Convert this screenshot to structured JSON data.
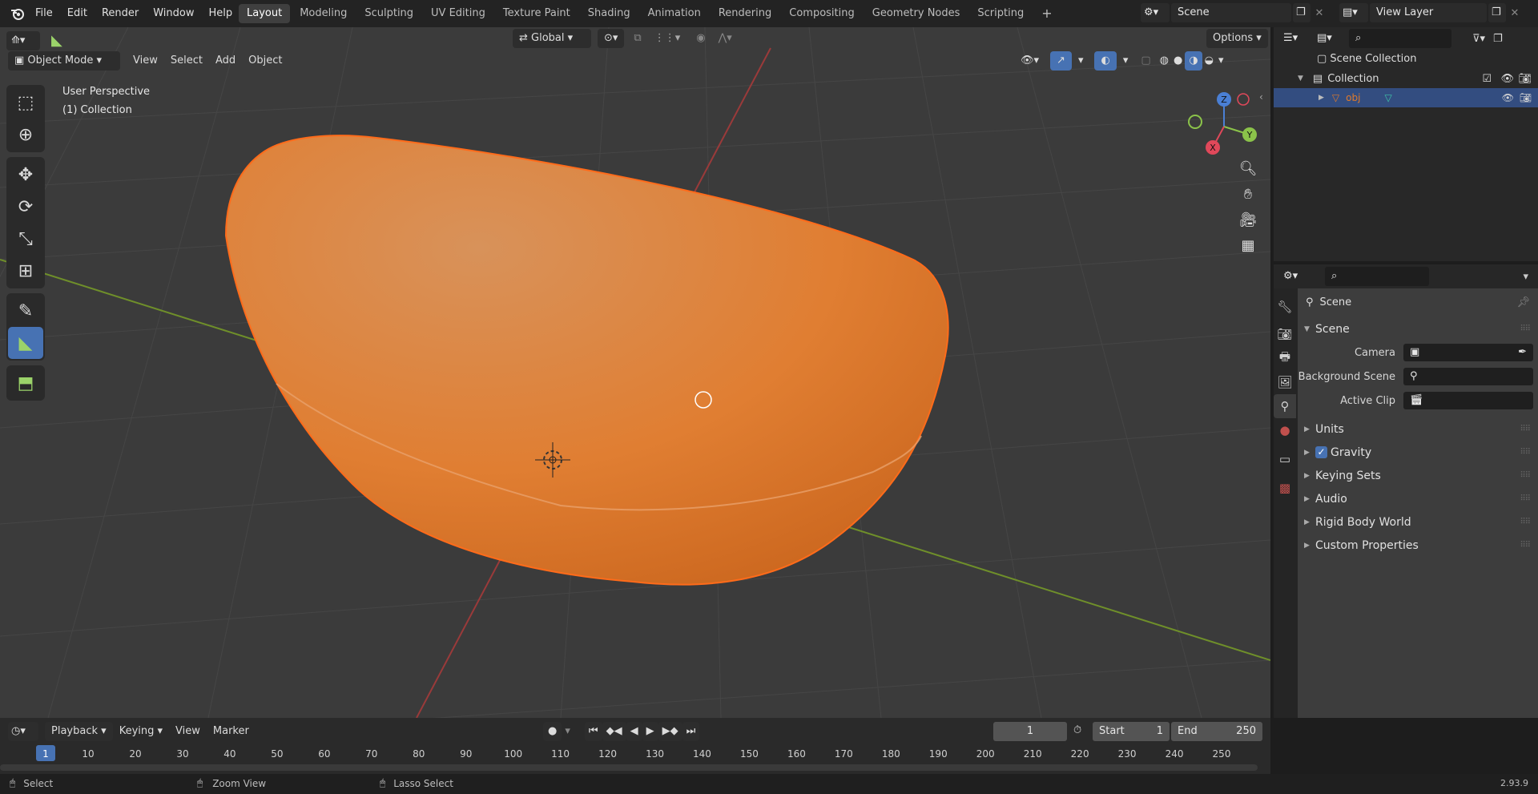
{
  "topbar": {
    "menus": [
      "File",
      "Edit",
      "Render",
      "Window",
      "Help"
    ],
    "workspaces": [
      "Layout",
      "Modeling",
      "Sculpting",
      "UV Editing",
      "Texture Paint",
      "Shading",
      "Animation",
      "Rendering",
      "Compositing",
      "Geometry Nodes",
      "Scripting"
    ],
    "active_workspace": "Layout",
    "scene_name": "Scene",
    "view_layer": "View Layer"
  },
  "viewport": {
    "mode": "Object Mode",
    "menus": [
      "View",
      "Select",
      "Add",
      "Object"
    ],
    "orientation": "Global",
    "options_label": "Options",
    "overlay_title": "User Perspective",
    "overlay_subtitle": "(1) Collection",
    "gizmo": {
      "x": "X",
      "y": "Y",
      "z": "Z"
    },
    "object_color": "#e07a2a",
    "grid_color": "#3b3b3b"
  },
  "outliner": {
    "root": "Scene Collection",
    "collection": "Collection",
    "object": "obj"
  },
  "properties": {
    "header": "Scene",
    "section": "Scene",
    "camera_label": "Camera",
    "background_scene_label": "Background Scene",
    "active_clip_label": "Active Clip",
    "subpanels": [
      "Units",
      "Gravity",
      "Keying Sets",
      "Audio",
      "Rigid Body World",
      "Custom Properties"
    ],
    "gravity_checked": true
  },
  "timeline": {
    "menus": [
      "Playback",
      "Keying",
      "View",
      "Marker"
    ],
    "current_frame": "1",
    "start_label": "Start",
    "start_value": "1",
    "end_label": "End",
    "end_value": "250",
    "ruler": [
      "1",
      "10",
      "20",
      "30",
      "40",
      "50",
      "60",
      "70",
      "80",
      "90",
      "100",
      "110",
      "120",
      "130",
      "140",
      "150",
      "160",
      "170",
      "180",
      "190",
      "200",
      "210",
      "220",
      "230",
      "240",
      "250"
    ]
  },
  "statusbar": {
    "select": "Select",
    "zoom_view": "Zoom View",
    "lasso_select": "Lasso Select",
    "version": "2.93.9"
  }
}
